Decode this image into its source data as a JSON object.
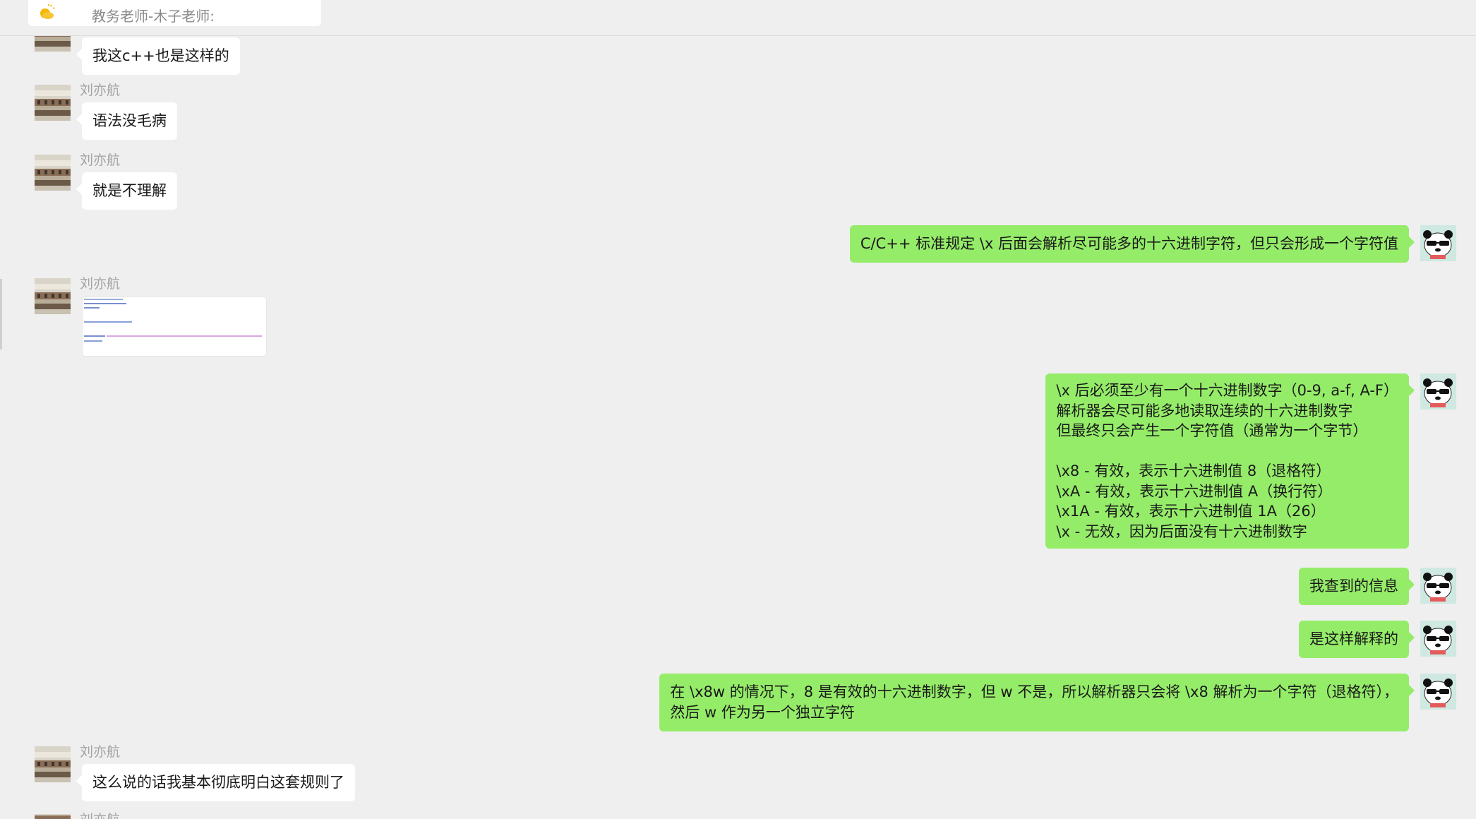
{
  "top_note": {
    "text": "教务老师-木子老师:"
  },
  "colors": {
    "bg": "#efefef",
    "in_bubble": "#ffffff",
    "out_bubble": "#95ec69",
    "sender": "#a3a3a3"
  },
  "messages": {
    "m1": {
      "text": "我这c++也是这样的"
    },
    "m2": {
      "sender": "刘亦航",
      "text": "语法没毛病"
    },
    "m3": {
      "sender": "刘亦航",
      "text": "就是不理解"
    },
    "m4": {
      "text": "C/C++ 标准规定 \\x 后面会解析尽可能多的十六进制字符，但只会形成一个字符值"
    },
    "m5": {
      "sender": "刘亦航"
    },
    "m6": {
      "text": "\\x 后必须至少有一个十六进制数字（0-9, a-f, A-F）\n解析器会尽可能多地读取连续的十六进制数字\n但最终只会产生一个字符值（通常为一个字节）\n\n\\x8 - 有效，表示十六进制值 8（退格符）\n\\xA - 有效，表示十六进制值 A（换行符）\n\\x1A - 有效，表示十六进制值 1A（26）\n\\x - 无效，因为后面没有十六进制数字"
    },
    "m7": {
      "text": "我查到的信息"
    },
    "m8": {
      "text": "是这样解释的"
    },
    "m9": {
      "text": "在 \\x8w 的情况下，8 是有效的十六进制数字，但 w 不是，所以解析器只会将 \\x8 解析为一个字符（退格符），\n然后 w 作为另一个独立字符"
    },
    "m10": {
      "sender": "刘亦航",
      "text": "这么说的话我基本彻底明白这套规则了"
    },
    "m11": {
      "sender": "刘亦航"
    }
  }
}
